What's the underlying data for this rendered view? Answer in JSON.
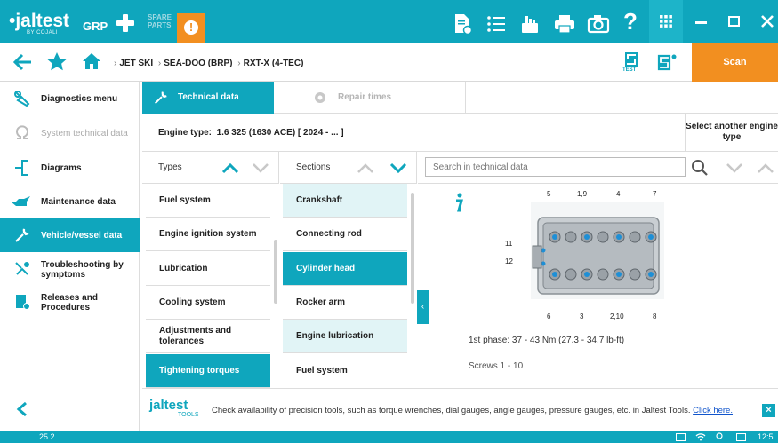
{
  "topbar": {
    "logo": "•jaltest",
    "logo_sub": "BY COJALI",
    "mode": "GRP",
    "spare_parts": "SPARE\nPARTS",
    "alert": "!"
  },
  "navbar": {
    "breadcrumb": [
      "JET SKI",
      "SEA-DOO (BRP)",
      "RXT-X (4-TEC)"
    ],
    "test_label": "TEST",
    "scan_label": "Scan"
  },
  "sidebar": {
    "items": [
      {
        "label": "Diagnostics menu",
        "icon": "wrench-clip-icon",
        "state": "normal"
      },
      {
        "label": "System technical data",
        "icon": "omega-icon",
        "state": "disabled"
      },
      {
        "label": "Diagrams",
        "icon": "diagram-icon",
        "state": "normal"
      },
      {
        "label": "Maintenance data",
        "icon": "oil-can-icon",
        "state": "normal"
      },
      {
        "label": "Vehicle/vessel data",
        "icon": "wrench-icon",
        "state": "active"
      },
      {
        "label": "Troubleshooting by symptoms",
        "icon": "troubleshoot-icon",
        "state": "normal"
      },
      {
        "label": "Releases and Procedures",
        "icon": "document-icon",
        "state": "normal"
      }
    ]
  },
  "tabs": [
    {
      "label": "Technical data",
      "state": "active"
    },
    {
      "label": "Repair times",
      "state": "inactive"
    }
  ],
  "engine": {
    "label": "Engine type:",
    "value": "1.6 325 (1630 ACE) [ 2024 - ... ]",
    "select_another": "Select another engine type"
  },
  "columns": {
    "types_header": "Types",
    "sections_header": "Sections",
    "search_placeholder": "Search in technical data"
  },
  "types": [
    {
      "label": "Fuel system",
      "active": false
    },
    {
      "label": "Engine ignition system",
      "active": false
    },
    {
      "label": "Lubrication",
      "active": false
    },
    {
      "label": "Cooling system",
      "active": false
    },
    {
      "label": "Adjustments and tolerances",
      "active": false
    },
    {
      "label": "Tightening torques",
      "active": true
    }
  ],
  "sections": [
    {
      "label": "Crankshaft",
      "state": "tinted"
    },
    {
      "label": "Connecting rod",
      "state": "plain"
    },
    {
      "label": "Cylinder head",
      "state": "active"
    },
    {
      "label": "Rocker arm",
      "state": "plain"
    },
    {
      "label": "Engine lubrication",
      "state": "tinted"
    },
    {
      "label": "Fuel system",
      "state": "plain"
    }
  ],
  "content": {
    "callouts_top": [
      "5",
      "1,9",
      "4",
      "7"
    ],
    "callouts_left": [
      "11",
      "12"
    ],
    "callouts_bottom": [
      "6",
      "3",
      "2,10",
      "8"
    ],
    "phase_text": "1st phase: 37 - 43 Nm (27.3 - 34.7 lb-ft)",
    "screws_text": "Screws 1 - 10"
  },
  "tools": {
    "logo": "jaltest",
    "logo_sub": "TOOLS",
    "text": "Check availability of precision tools, such as torque wrenches, dial gauges, angle gauges, pressure gauges, etc. in Jaltest Tools.",
    "link": "Click here.",
    "close": "×"
  },
  "status": {
    "version": "25.2",
    "time": "12:5"
  },
  "colors": {
    "accent": "#0fa6bd",
    "orange": "#f28f20",
    "tint": "#e1f4f6"
  }
}
